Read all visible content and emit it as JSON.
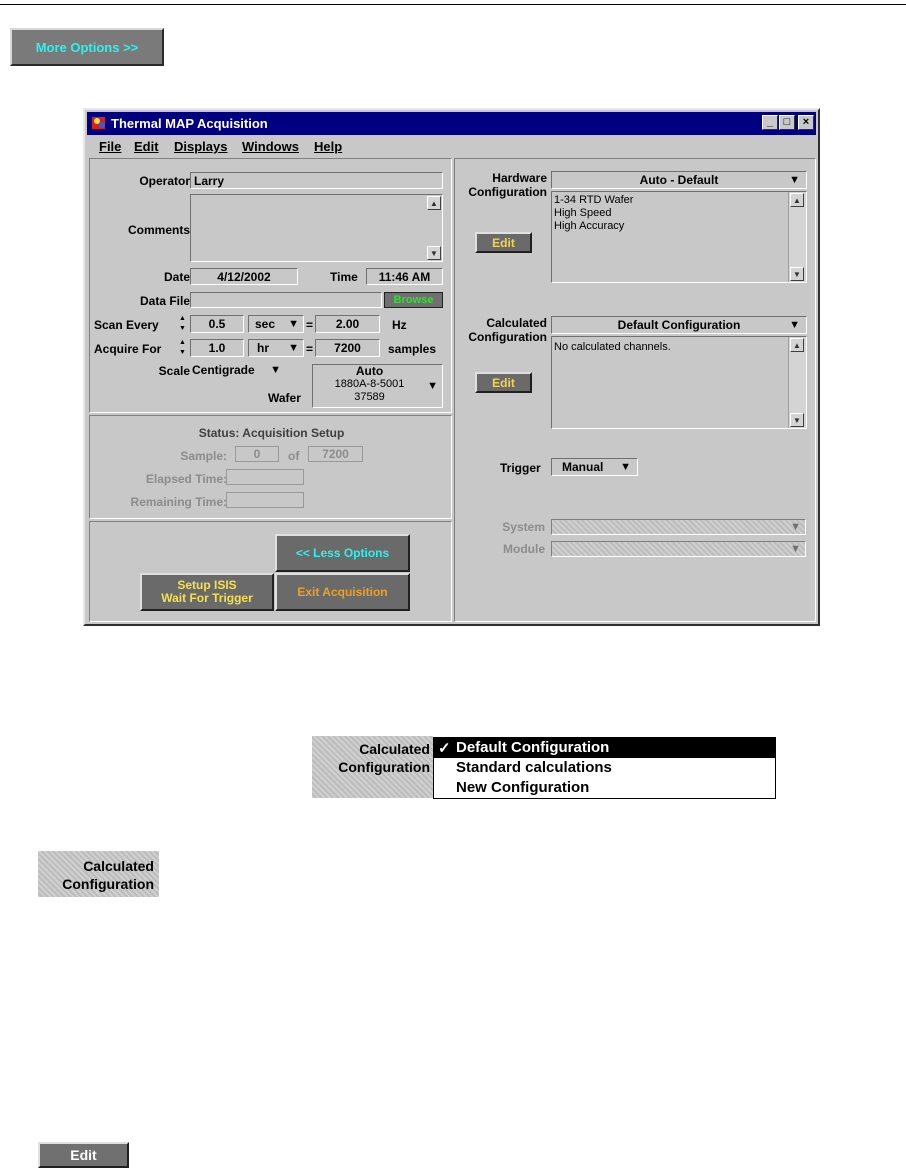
{
  "more_options_label": "More Options >>",
  "window": {
    "title": "Thermal MAP Acquisition",
    "minimize": "_",
    "maximize": "□",
    "close": "×"
  },
  "menu": [
    "File",
    "Edit",
    "Displays",
    "Windows",
    "Help"
  ],
  "form": {
    "operator_label": "Operator",
    "operator_value": "Larry",
    "comments_label": "Comments",
    "date_label": "Date",
    "date_value": "4/12/2002",
    "time_label": "Time",
    "time_value": "11:46 AM",
    "datafile_label": "Data File",
    "browse_label": "Browse",
    "scan_label": "Scan Every",
    "scan_value": "0.5",
    "scan_unit": "sec",
    "scan_rate": "2.00",
    "scan_rate_unit": "Hz",
    "acquire_label": "Acquire For",
    "acquire_value": "1.0",
    "acquire_unit": "hr",
    "acquire_samples": "7200",
    "acquire_samples_unit": "samples",
    "eq": "=",
    "scale_label": "Scale",
    "scale_value": "Centigrade",
    "wafer_label": "Wafer",
    "wafer_line1": "Auto",
    "wafer_line2": "1880A-8-5001",
    "wafer_line3": "37589"
  },
  "status": {
    "title": "Status: Acquisition Setup",
    "sample_label": "Sample:",
    "sample_value": "0",
    "of_label": "of",
    "sample_total": "7200",
    "elapsed_label": "Elapsed Time:",
    "remaining_label": "Remaining Time:"
  },
  "buttons": {
    "less_options": "<< Less Options",
    "setup_line1": "Setup ISIS",
    "setup_line2": "Wait For Trigger",
    "exit": "Exit Acquisition",
    "edit": "Edit"
  },
  "hardware": {
    "label_line1": "Hardware",
    "label_line2": "Configuration",
    "selected": "Auto - Default",
    "items": [
      "1-34 RTD Wafer",
      "High Speed",
      "High Accuracy"
    ]
  },
  "calculated": {
    "label_line1": "Calculated",
    "label_line2": "Configuration",
    "selected": "Default Configuration",
    "items": [
      "No calculated channels."
    ]
  },
  "trigger": {
    "label": "Trigger",
    "value": "Manual"
  },
  "system_label": "System",
  "module_label": "Module",
  "callout": {
    "label_line1": "Calculated",
    "label_line2": "Configuration"
  },
  "dropdown": {
    "label_line1": "Calculated",
    "label_line2": "Configuration",
    "checkmark": "✓",
    "options": [
      "Default Configuration",
      "Standard calculations",
      "New Configuration"
    ]
  },
  "edit_callout": "Edit"
}
